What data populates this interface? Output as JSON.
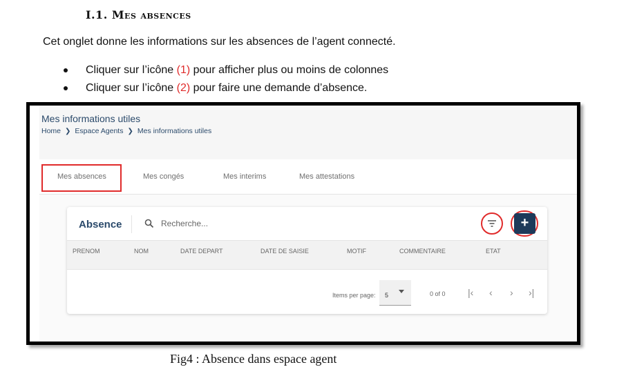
{
  "section": {
    "number": "I.1.",
    "title": "Mes absences"
  },
  "intro": "Cet onglet donne les informations sur les absences de l’agent connecté.",
  "bullets": [
    {
      "prefix": "Cliquer sur l’icône ",
      "marker": "(1)",
      "suffix": " pour  afficher plus ou moins de colonnes"
    },
    {
      "prefix": "Cliquer sur l’icône ",
      "marker": "(2)",
      "suffix": " pour faire une demande d’absence."
    }
  ],
  "app": {
    "title": "Mes informations utiles",
    "breadcrumb": [
      "Home",
      "Espace Agents",
      "Mes informations utiles"
    ],
    "tabs": [
      "Mes absences",
      "Mes congés",
      "Mes interims",
      "Mes attestations"
    ],
    "card": {
      "title": "Absence",
      "search_placeholder": "Recherche...",
      "add_label": "+",
      "columns": [
        "PRENOM",
        "NOM",
        "DATE DEPART",
        "DATE DE SAISIE",
        "MOTIF",
        "COMMENTAIRE",
        "ETAT"
      ],
      "rows": [],
      "paginator": {
        "items_per_page_label": "Items per page:",
        "items_per_page": "5",
        "range": "0 of 0"
      }
    },
    "accent_color": "#1e3a5a",
    "highlight_color": "#e02a2a"
  },
  "caption": "Fig4 : Absence dans espace agent"
}
